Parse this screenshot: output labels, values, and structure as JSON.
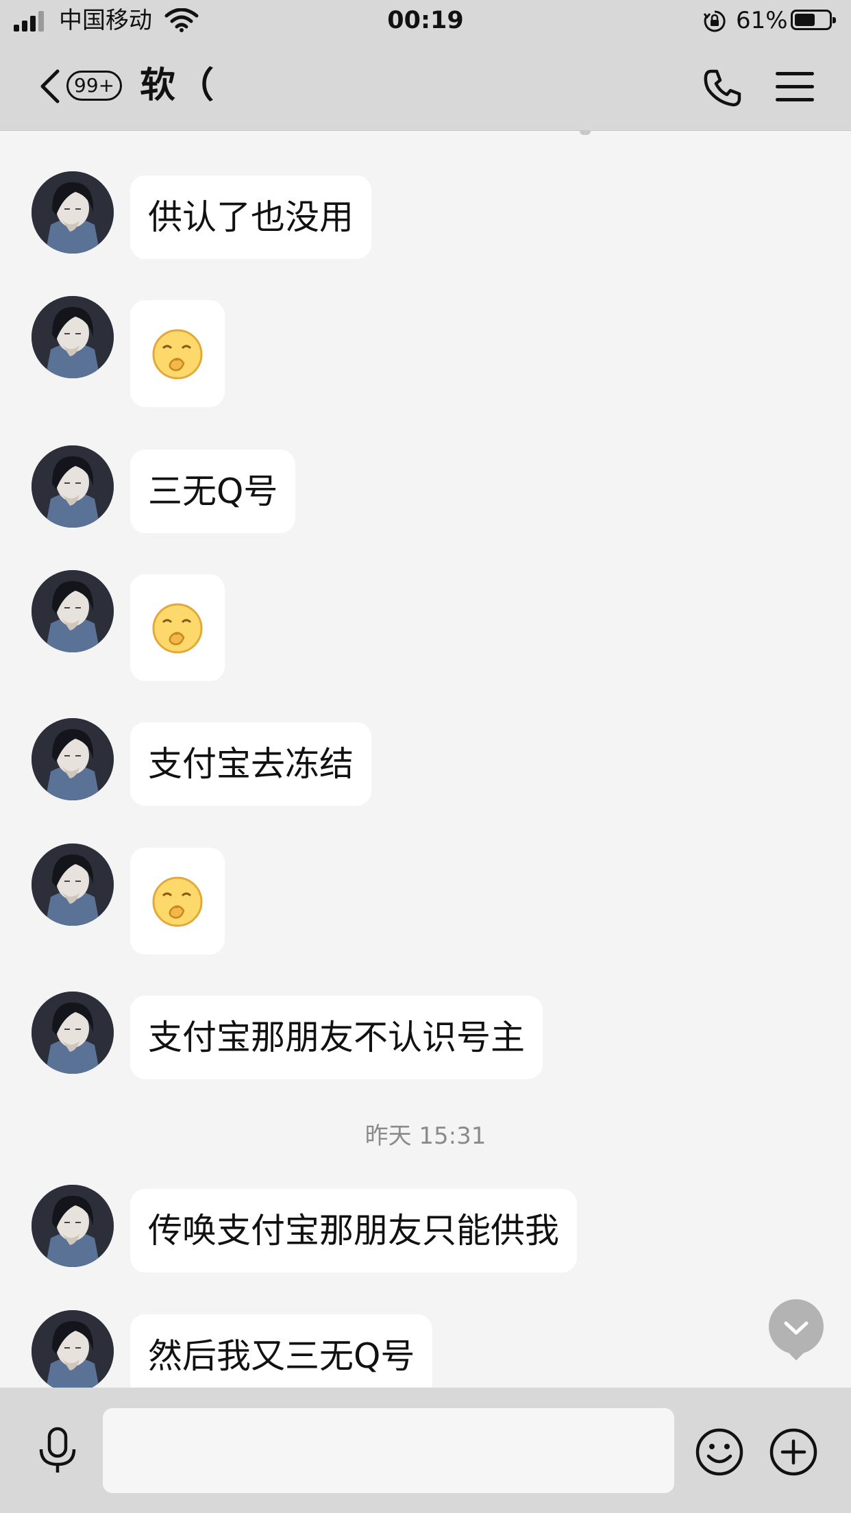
{
  "status_bar": {
    "carrier": "中国移动",
    "time": "00:19",
    "battery_percent": "61%",
    "battery_level": 0.61,
    "signal_bars": 3,
    "icons": [
      "signal-icon",
      "wifi-icon",
      "rotation-lock-icon",
      "battery-icon"
    ]
  },
  "nav": {
    "back_icon": "chevron-left-icon",
    "unread_badge": "99+",
    "title": "软（",
    "call_icon": "phone-icon",
    "menu_icon": "menu-icon"
  },
  "messages": [
    {
      "type": "text",
      "text": "供认了也没用"
    },
    {
      "type": "emoji",
      "emoji": "shy-smile-emoji"
    },
    {
      "type": "text",
      "text": "三无Q号"
    },
    {
      "type": "emoji",
      "emoji": "shy-smile-emoji"
    },
    {
      "type": "text",
      "text": "支付宝去冻结"
    },
    {
      "type": "emoji",
      "emoji": "shy-smile-emoji"
    },
    {
      "type": "text",
      "text": "支付宝那朋友不认识号主"
    },
    {
      "type": "timestamp",
      "text": "昨天 15:31"
    },
    {
      "type": "text",
      "text": "传唤支付宝那朋友只能供我"
    },
    {
      "type": "text",
      "text": "然后我又三无Q号"
    }
  ],
  "scroll_down_icon": "chevron-down-icon",
  "input_bar": {
    "mic_icon": "microphone-icon",
    "input_value": "",
    "emoji_icon": "smiley-icon",
    "plus_icon": "plus-circle-icon"
  },
  "colors": {
    "bar_background": "#d8d8d8",
    "chat_background": "#f4f4f4",
    "bubble_background": "#ffffff",
    "timestamp_text": "#8a8a8a"
  }
}
